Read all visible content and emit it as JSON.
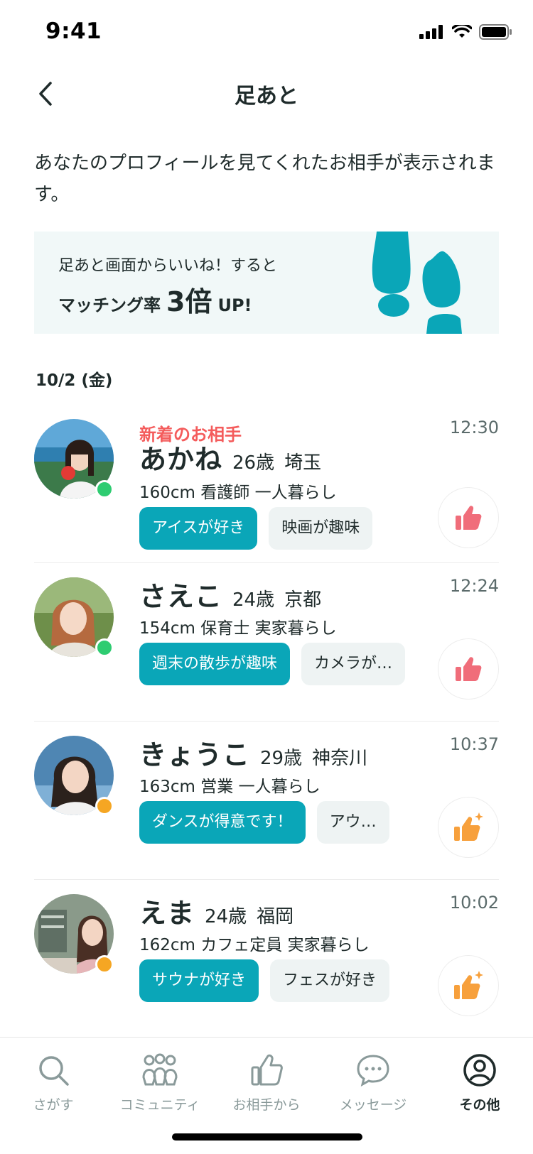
{
  "status_bar": {
    "time": "9:41"
  },
  "header": {
    "title": "足あと"
  },
  "description": "あなたのプロフィールを見てくれたお相手が表示されます。",
  "banner": {
    "line1": "足あと画面からいいね！すると",
    "line2_prefix": "マッチング率",
    "line2_big": "3倍",
    "line2_suffix": "UP!"
  },
  "date_header": "10/2 (金)",
  "colors": {
    "accent": "#0aa6b8",
    "new": "#f45c5c",
    "online": "#2ecc71",
    "away": "#f5a623",
    "like_red": "#f06d7a",
    "like_orange": "#f7a03c"
  },
  "footprints": [
    {
      "badge": "新着のお相手",
      "name": "あかね",
      "age": "26歳",
      "pref": "埼玉",
      "details": "160cm 看護師 一人暮らし",
      "tags": [
        "アイスが好き",
        "映画が趣味"
      ],
      "time": "12:30",
      "status": "online",
      "like_icon": "thumb-up-icon"
    },
    {
      "badge": "",
      "name": "さえこ",
      "age": "24歳",
      "pref": "京都",
      "details": "154cm 保育士 実家暮らし",
      "tags": [
        "週末の散歩が趣味",
        "カメラが…"
      ],
      "time": "12:24",
      "status": "online",
      "like_icon": "thumb-up-icon"
    },
    {
      "badge": "",
      "name": "きょうこ",
      "age": "29歳",
      "pref": "神奈川",
      "details": "163cm 営業 一人暮らし",
      "tags": [
        "ダンスが得意です！",
        "アウ…"
      ],
      "time": "10:37",
      "status": "away",
      "like_icon": "thumb-up-sparkle-icon"
    },
    {
      "badge": "",
      "name": "えま",
      "age": "24歳",
      "pref": "福岡",
      "details": "162cm カフェ定員 実家暮らし",
      "tags": [
        "サウナが好き",
        "フェスが好き"
      ],
      "time": "10:02",
      "status": "away",
      "like_icon": "thumb-up-sparkle-icon"
    }
  ],
  "tabbar": {
    "tabs": [
      {
        "label": "さがす",
        "icon": "search-icon"
      },
      {
        "label": "コミュニティ",
        "icon": "community-icon"
      },
      {
        "label": "お相手から",
        "icon": "thumb-up-icon"
      },
      {
        "label": "メッセージ",
        "icon": "chat-icon"
      },
      {
        "label": "その他",
        "icon": "profile-icon",
        "active": true
      }
    ]
  }
}
